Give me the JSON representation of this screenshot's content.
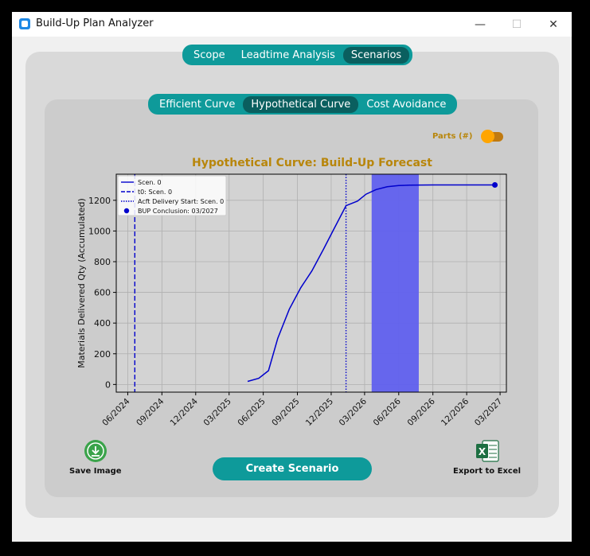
{
  "window": {
    "title": "Build-Up Plan Analyzer",
    "controls": {
      "minimize": "—",
      "maximize": "☐",
      "close": "✕"
    }
  },
  "main_tabs": [
    {
      "label": "Scope",
      "active": false
    },
    {
      "label": "Leadtime Analysis",
      "active": false
    },
    {
      "label": "Scenarios",
      "active": true
    }
  ],
  "sub_tabs": [
    {
      "label": "Efficient Curve",
      "active": false
    },
    {
      "label": "Hypothetical Curve",
      "active": true
    },
    {
      "label": "Cost Avoidance",
      "active": false
    }
  ],
  "parts_toggle": {
    "label": "Parts (#)",
    "on": true
  },
  "actions": {
    "save_image": "Save Image",
    "create_scenario": "Create Scenario",
    "export_excel": "Export to Excel"
  },
  "colors": {
    "teal": "#0e9a9a",
    "teal_active": "#0a5f5f",
    "curve": "#0000cc",
    "shade": "#6060ee",
    "title_gold": "#b8860b",
    "toggle": "#ffa500"
  },
  "chart_data": {
    "type": "line",
    "title": "Hypothetical Curve: Build-Up Forecast",
    "xlabel": "",
    "ylabel": "Materials Delivered Qty (Accumulated)",
    "grid": true,
    "legend_position": "top-left",
    "xlim": [
      "2024-05-01",
      "2027-03-18"
    ],
    "ylim": [
      -50,
      1370
    ],
    "x_ticks": [
      "06/2024",
      "09/2024",
      "12/2024",
      "03/2025",
      "06/2025",
      "09/2025",
      "12/2025",
      "03/2026",
      "06/2026",
      "09/2026",
      "12/2026",
      "03/2027"
    ],
    "y_ticks": [
      0,
      200,
      400,
      600,
      800,
      1000,
      1200
    ],
    "series": [
      {
        "name": "Scen. 0",
        "style": "solid",
        "x": [
          "2025-04-20",
          "2025-05-20",
          "2025-06-15",
          "2025-07-10",
          "2025-08-10",
          "2025-09-10",
          "2025-10-10",
          "2025-11-10",
          "2025-12-10",
          "2026-01-10",
          "2026-02-10",
          "2026-03-05",
          "2026-04-01",
          "2026-05-01",
          "2026-06-01",
          "2026-07-01",
          "2026-09-01",
          "2026-12-01",
          "2027-02-15"
        ],
        "y": [
          20,
          40,
          90,
          300,
          490,
          630,
          740,
          880,
          1020,
          1165,
          1195,
          1240,
          1270,
          1288,
          1296,
          1299,
          1300,
          1300,
          1300
        ]
      }
    ],
    "reference_lines": [
      {
        "name": "t0: Scen. 0",
        "style": "dashed",
        "x": "2024-06-20"
      },
      {
        "name": "Acft Delivery Start: Scen. 0",
        "style": "dotted",
        "x": "2026-01-10"
      }
    ],
    "markers": [
      {
        "name": "BUP Conclusion: 03/2027",
        "x": "2027-02-15",
        "y": 1300
      }
    ],
    "shaded_band": {
      "x_start": "2026-03-20",
      "x_end": "2026-07-25"
    }
  }
}
